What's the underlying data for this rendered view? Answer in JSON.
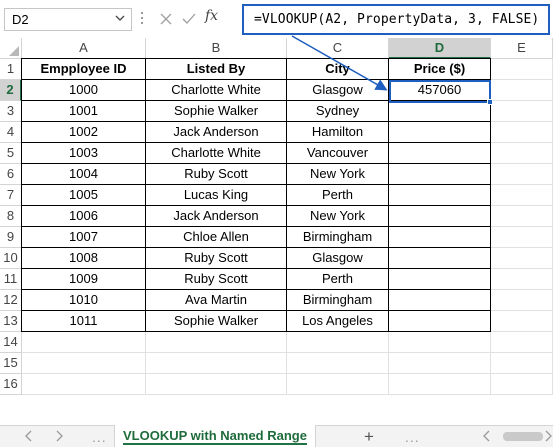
{
  "formula_bar": {
    "name_box": "D2",
    "fx_label": "fx",
    "formula": "=VLOOKUP(A2, PropertyData, 3, FALSE)"
  },
  "columns": [
    "A",
    "B",
    "C",
    "D",
    "E"
  ],
  "selected_column": "D",
  "selected_row": "2",
  "row_numbers": [
    "1",
    "2",
    "3",
    "4",
    "5",
    "6",
    "7",
    "8",
    "9",
    "10",
    "11",
    "12",
    "13",
    "14",
    "15",
    "16"
  ],
  "table": {
    "headers": [
      "Empployee ID",
      "Listed By",
      "City",
      "Price ($)"
    ],
    "rows": [
      [
        "1000",
        "Charlotte White",
        "Glasgow",
        "457060"
      ],
      [
        "1001",
        "Sophie Walker",
        "Sydney",
        ""
      ],
      [
        "1002",
        "Jack Anderson",
        "Hamilton",
        ""
      ],
      [
        "1003",
        "Charlotte White",
        "Vancouver",
        ""
      ],
      [
        "1004",
        "Ruby Scott",
        "New York",
        ""
      ],
      [
        "1005",
        "Lucas King",
        "Perth",
        ""
      ],
      [
        "1006",
        "Jack Anderson",
        "New York",
        ""
      ],
      [
        "1007",
        "Chloe Allen",
        "Birmingham",
        ""
      ],
      [
        "1008",
        "Ruby Scott",
        "Glasgow",
        ""
      ],
      [
        "1009",
        "Ruby Scott",
        "Perth",
        ""
      ],
      [
        "1010",
        "Ava Martin",
        "Birmingham",
        ""
      ],
      [
        "1011",
        "Sophie Walker",
        "Los Angeles",
        ""
      ]
    ]
  },
  "sheet_tabs": {
    "active": "VLOOKUP with Named Range",
    "dots": "...",
    "add": "+"
  },
  "colors": {
    "accent_blue": "#1f5fbf",
    "excel_green": "#217346"
  }
}
